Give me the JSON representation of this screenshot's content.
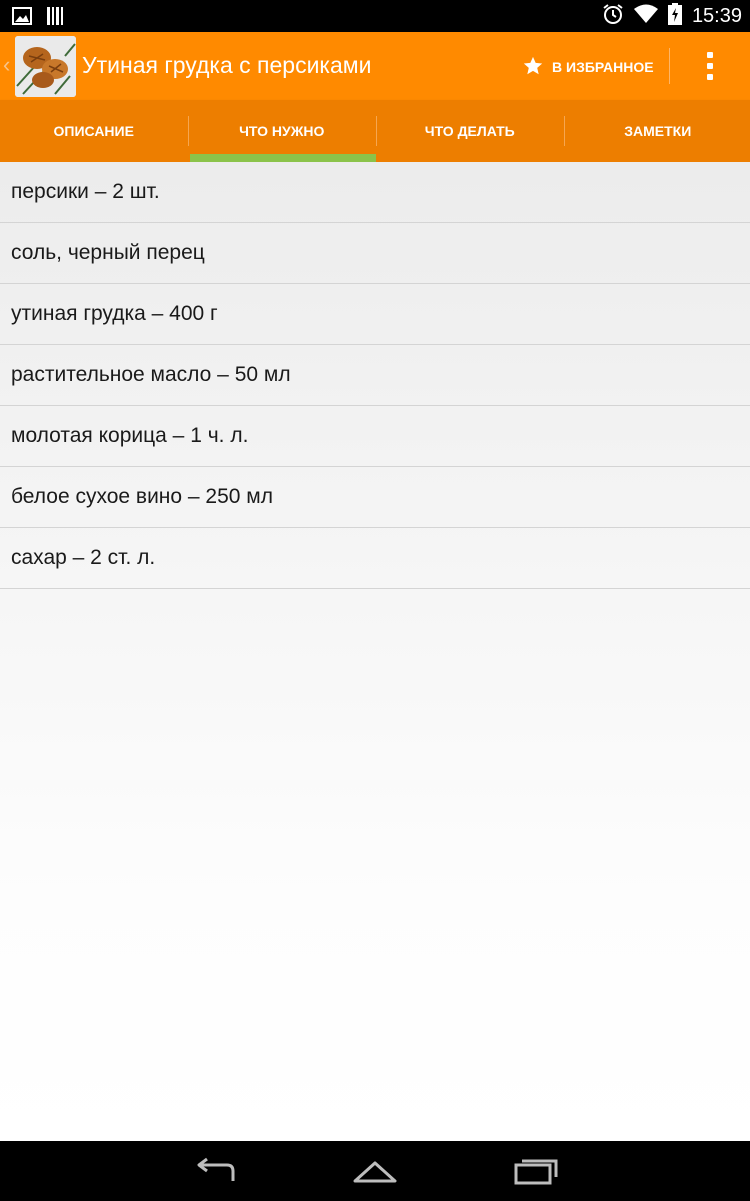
{
  "status_bar": {
    "time": "15:39",
    "icons": [
      "picture-icon",
      "barcode-icon",
      "alarm-icon",
      "wifi-icon",
      "battery-charging-icon"
    ]
  },
  "action_bar": {
    "title": "Утиная грудка с персиками",
    "favorite_label": "В ИЗБРАННОЕ",
    "icons": [
      "back-chevron-icon",
      "recipe-thumbnail",
      "star-icon",
      "overflow-menu-icon"
    ]
  },
  "tabs": [
    {
      "label": "ОПИСАНИЕ",
      "selected": false
    },
    {
      "label": "ЧТО НУЖНО",
      "selected": true
    },
    {
      "label": "ЧТО ДЕЛАТЬ",
      "selected": false
    },
    {
      "label": "ЗАМЕТКИ",
      "selected": false
    }
  ],
  "ingredients": [
    "персики – 2 шт.",
    "соль, черный перец",
    "утиная грудка – 400 г",
    "растительное масло – 50 мл",
    "молотая корица – 1 ч. л.",
    "белое сухое вино – 250 мл",
    "сахар – 2 ст. л."
  ],
  "nav_bar": {
    "icons": [
      "back-icon",
      "home-icon",
      "recent-apps-icon"
    ]
  },
  "colors": {
    "action_bar": "#ff8a00",
    "tab_bar": "#ed7e00",
    "tab_indicator": "#8bc34a"
  }
}
